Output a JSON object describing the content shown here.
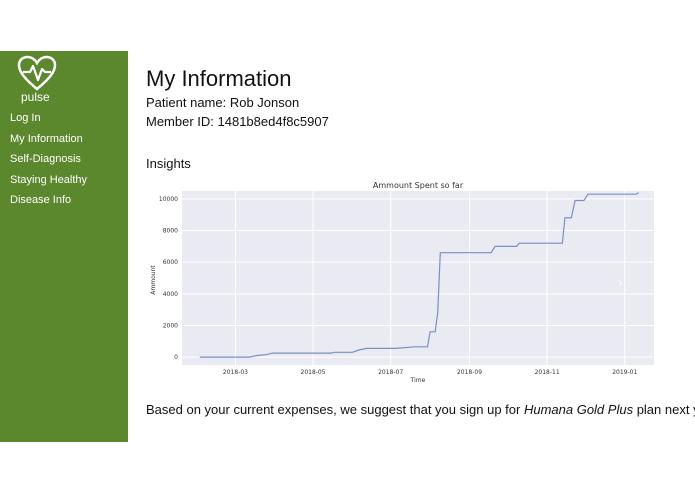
{
  "sidebar": {
    "brand": "pulse",
    "logo_icon": "heart-pulse-icon",
    "items": [
      {
        "label": "Log In"
      },
      {
        "label": "My Information"
      },
      {
        "label": "Self-Diagnosis"
      },
      {
        "label": "Staying Healthy"
      },
      {
        "label": "Disease Info"
      }
    ],
    "color": "#5b872d"
  },
  "main": {
    "title": "My Information",
    "patient_name": "Patient name: Rob Jonson",
    "member_id": "Member ID: 1481b8ed4f8c5907",
    "insights_heading": "Insights",
    "suggestion_prefix": "Based on your current expenses, we suggest that you sign up for ",
    "suggestion_plan": "Humana Gold Plus",
    "suggestion_suffix": " plan next year."
  },
  "chart_data": {
    "type": "line",
    "title": "Ammount Spent so far",
    "xlabel": "Time",
    "ylabel": "Ammount",
    "xlim": [
      "2018-01-18",
      "2019-01-24"
    ],
    "ylim": [
      -500,
      10500
    ],
    "xticks": [
      "2018-03",
      "2018-05",
      "2018-07",
      "2018-09",
      "2018-11",
      "2019-01"
    ],
    "yticks": [
      0,
      2000,
      4000,
      6000,
      8000,
      10000
    ],
    "grid": true,
    "series": [
      {
        "color": "#7b8fc4",
        "points": [
          [
            "2018-02-01",
            0
          ],
          [
            "2018-03-12",
            0
          ],
          [
            "2018-03-18",
            100
          ],
          [
            "2018-03-25",
            150
          ],
          [
            "2018-03-30",
            250
          ],
          [
            "2018-05-15",
            250
          ],
          [
            "2018-05-18",
            300
          ],
          [
            "2018-06-01",
            300
          ],
          [
            "2018-06-06",
            450
          ],
          [
            "2018-06-12",
            550
          ],
          [
            "2018-07-05",
            550
          ],
          [
            "2018-07-12",
            600
          ],
          [
            "2018-07-20",
            650
          ],
          [
            "2018-07-30",
            650
          ],
          [
            "2018-08-01",
            1600
          ],
          [
            "2018-08-05",
            1600
          ],
          [
            "2018-08-07",
            2800
          ],
          [
            "2018-08-09",
            6600
          ],
          [
            "2018-09-18",
            6600
          ],
          [
            "2018-09-21",
            7000
          ],
          [
            "2018-10-08",
            7000
          ],
          [
            "2018-10-10",
            7200
          ],
          [
            "2018-11-13",
            7200
          ],
          [
            "2018-11-15",
            8800
          ],
          [
            "2018-11-20",
            8800
          ],
          [
            "2018-11-23",
            9900
          ],
          [
            "2018-11-30",
            9900
          ],
          [
            "2018-12-03",
            10300
          ],
          [
            "2019-01-10",
            10300
          ],
          [
            "2019-01-12",
            10400
          ]
        ]
      }
    ]
  },
  "carousel": {
    "prev_icon": "chevron-left-icon",
    "next_icon": "chevron-right-icon",
    "prev_glyph": "‹",
    "next_glyph": "›"
  }
}
